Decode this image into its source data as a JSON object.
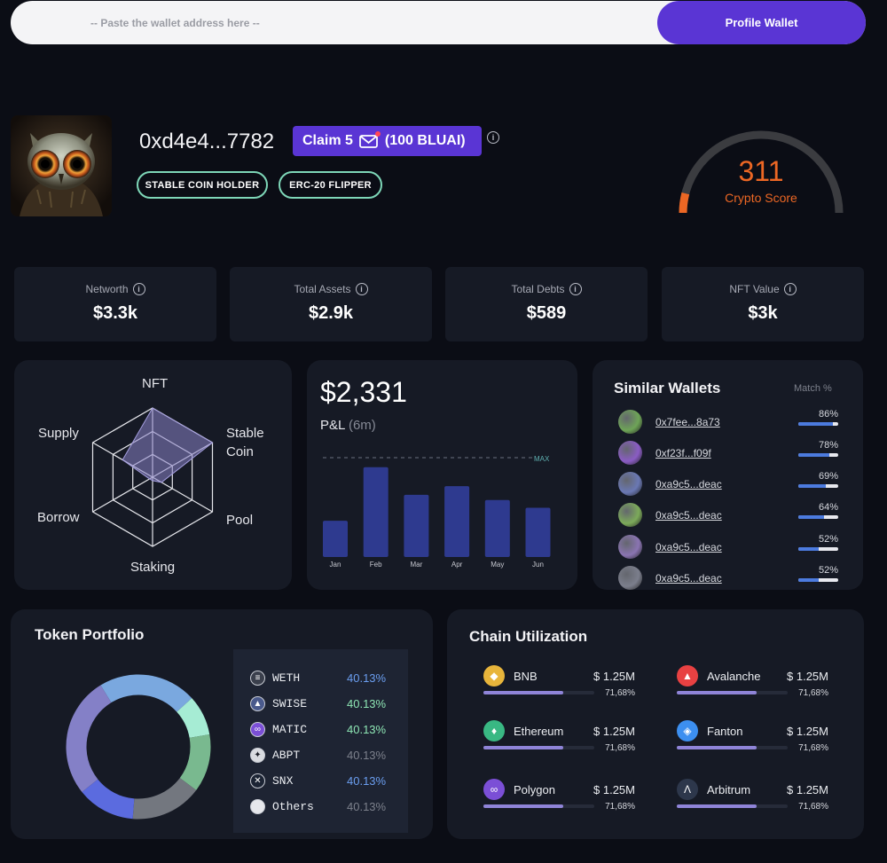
{
  "search": {
    "placeholder": "-- Paste the wallet address here --",
    "button_label": "Profile Wallet"
  },
  "profile": {
    "address": "0xd4e4...7782",
    "claim_label": "Claim 5",
    "claim_reward": "(100 BLUAI)",
    "badges": [
      "STABLE COIN HOLDER",
      "ERC-20 FLIPPER"
    ],
    "score": "311",
    "score_label": "Crypto Score",
    "score_fraction": 0.08,
    "colors": {
      "accent": "#5a35d4",
      "score": "#ec6724",
      "badge_border": "#7ed7b8"
    }
  },
  "stats": [
    {
      "label": "Networth",
      "value": "$3.3k"
    },
    {
      "label": "Total Assets",
      "value": "$2.9k"
    },
    {
      "label": "Total Debts",
      "value": "$589"
    },
    {
      "label": "NFT Value",
      "value": "$3k"
    }
  ],
  "radar": {
    "axes": [
      "NFT",
      "Stable",
      "Coin",
      "Pool",
      "Staking",
      "Borrow",
      "Supply"
    ],
    "levels": {
      "NFT": 1.0,
      "Stable Coin": 1.0,
      "Pool": 0.15,
      "Staking": 0.05,
      "Borrow": 0.05,
      "Supply": 0.5
    }
  },
  "pnl": {
    "value": "$2,331",
    "label": "P&L",
    "period": "(6m)",
    "max_label": "MAX"
  },
  "chart_data": {
    "type": "bar",
    "categories": [
      "Jan",
      "Feb",
      "Mar",
      "Apr",
      "May",
      "Jun"
    ],
    "values": [
      42,
      104,
      72,
      82,
      66,
      57
    ],
    "max": 115,
    "title": "",
    "xlabel": "",
    "ylabel": ""
  },
  "similar_wallets": {
    "title": "Similar Wallets",
    "match_label": "Match %",
    "items": [
      {
        "address": "0x7fee...8a73",
        "match": "86%",
        "pct": 86,
        "color": "#6ea457"
      },
      {
        "address": "0xf23f...f09f",
        "match": "78%",
        "pct": 78,
        "color": "#8a5cc4"
      },
      {
        "address": "0xa9c5...deac",
        "match": "69%",
        "pct": 69,
        "color": "#6a78b4"
      },
      {
        "address": "0xa9c5...deac",
        "match": "64%",
        "pct": 64,
        "color": "#7caa5a"
      },
      {
        "address": "0xa9c5...deac",
        "match": "52%",
        "pct": 52,
        "color": "#8a74b2"
      },
      {
        "address": "0xa9c5...deac",
        "match": "52%",
        "pct": 52,
        "color": "#7b7e8c"
      }
    ]
  },
  "token_portfolio": {
    "title": "Token Portfolio",
    "tokens": [
      {
        "name": "WETH",
        "pct": "40.13%",
        "pct_color": "#6b9ef0",
        "icon": "weth-icon",
        "icon_color": "#3a3f4c"
      },
      {
        "name": "SWISE",
        "pct": "40.13%",
        "pct_color": "#8ee6b4",
        "icon": "swise-icon",
        "icon_color": "#4a5a8c"
      },
      {
        "name": "MATIC",
        "pct": "40.13%",
        "pct_color": "#8ee6b4",
        "icon": "matic-icon",
        "icon_color": "#7b4fd6"
      },
      {
        "name": "ABPT",
        "pct": "40.13%",
        "pct_color": "#7d818c",
        "icon": "abpt-icon",
        "icon_color": "#d9dbe0"
      },
      {
        "name": "SNX",
        "pct": "40.13%",
        "pct_color": "#6b9ef0",
        "icon": "snx-icon",
        "icon_color": "#1c2434"
      },
      {
        "name": "Others",
        "pct": "40.13%",
        "pct_color": "#7d818c",
        "icon": "others-icon",
        "icon_color": "#e6e7ec"
      }
    ],
    "donut": [
      {
        "value": 22,
        "color": "#7aa8df"
      },
      {
        "value": 9,
        "color": "#a6ecd4"
      },
      {
        "value": 13,
        "color": "#79b98f"
      },
      {
        "value": 16,
        "color": "#73777f"
      },
      {
        "value": 13,
        "color": "#5b6bdf"
      },
      {
        "value": 27,
        "color": "#8480c7"
      }
    ]
  },
  "chain_utilization": {
    "title": "Chain Utilization",
    "chains": [
      {
        "name": "BNB",
        "value": "$ 1.25M",
        "pct": "71,68%",
        "fill": 0.72,
        "icon": "bnb-icon",
        "color": "#e8b53b"
      },
      {
        "name": "Avalanche",
        "value": "$ 1.25M",
        "pct": "71,68%",
        "fill": 0.72,
        "icon": "avalanche-icon",
        "color": "#e84142"
      },
      {
        "name": "Ethereum",
        "value": "$ 1.25M",
        "pct": "71,68%",
        "fill": 0.72,
        "icon": "ethereum-icon",
        "color": "#39b883"
      },
      {
        "name": "Fanton",
        "value": "$ 1.25M",
        "pct": "71,68%",
        "fill": 0.72,
        "icon": "fantom-icon",
        "color": "#3c8ff0"
      },
      {
        "name": "Polygon",
        "value": "$ 1.25M",
        "pct": "71,68%",
        "fill": 0.72,
        "icon": "polygon-icon",
        "color": "#7b4fd6"
      },
      {
        "name": "Arbitrum",
        "value": "$ 1.25M",
        "pct": "71,68%",
        "fill": 0.72,
        "icon": "arbitrum-icon",
        "color": "#2d374b"
      }
    ]
  }
}
